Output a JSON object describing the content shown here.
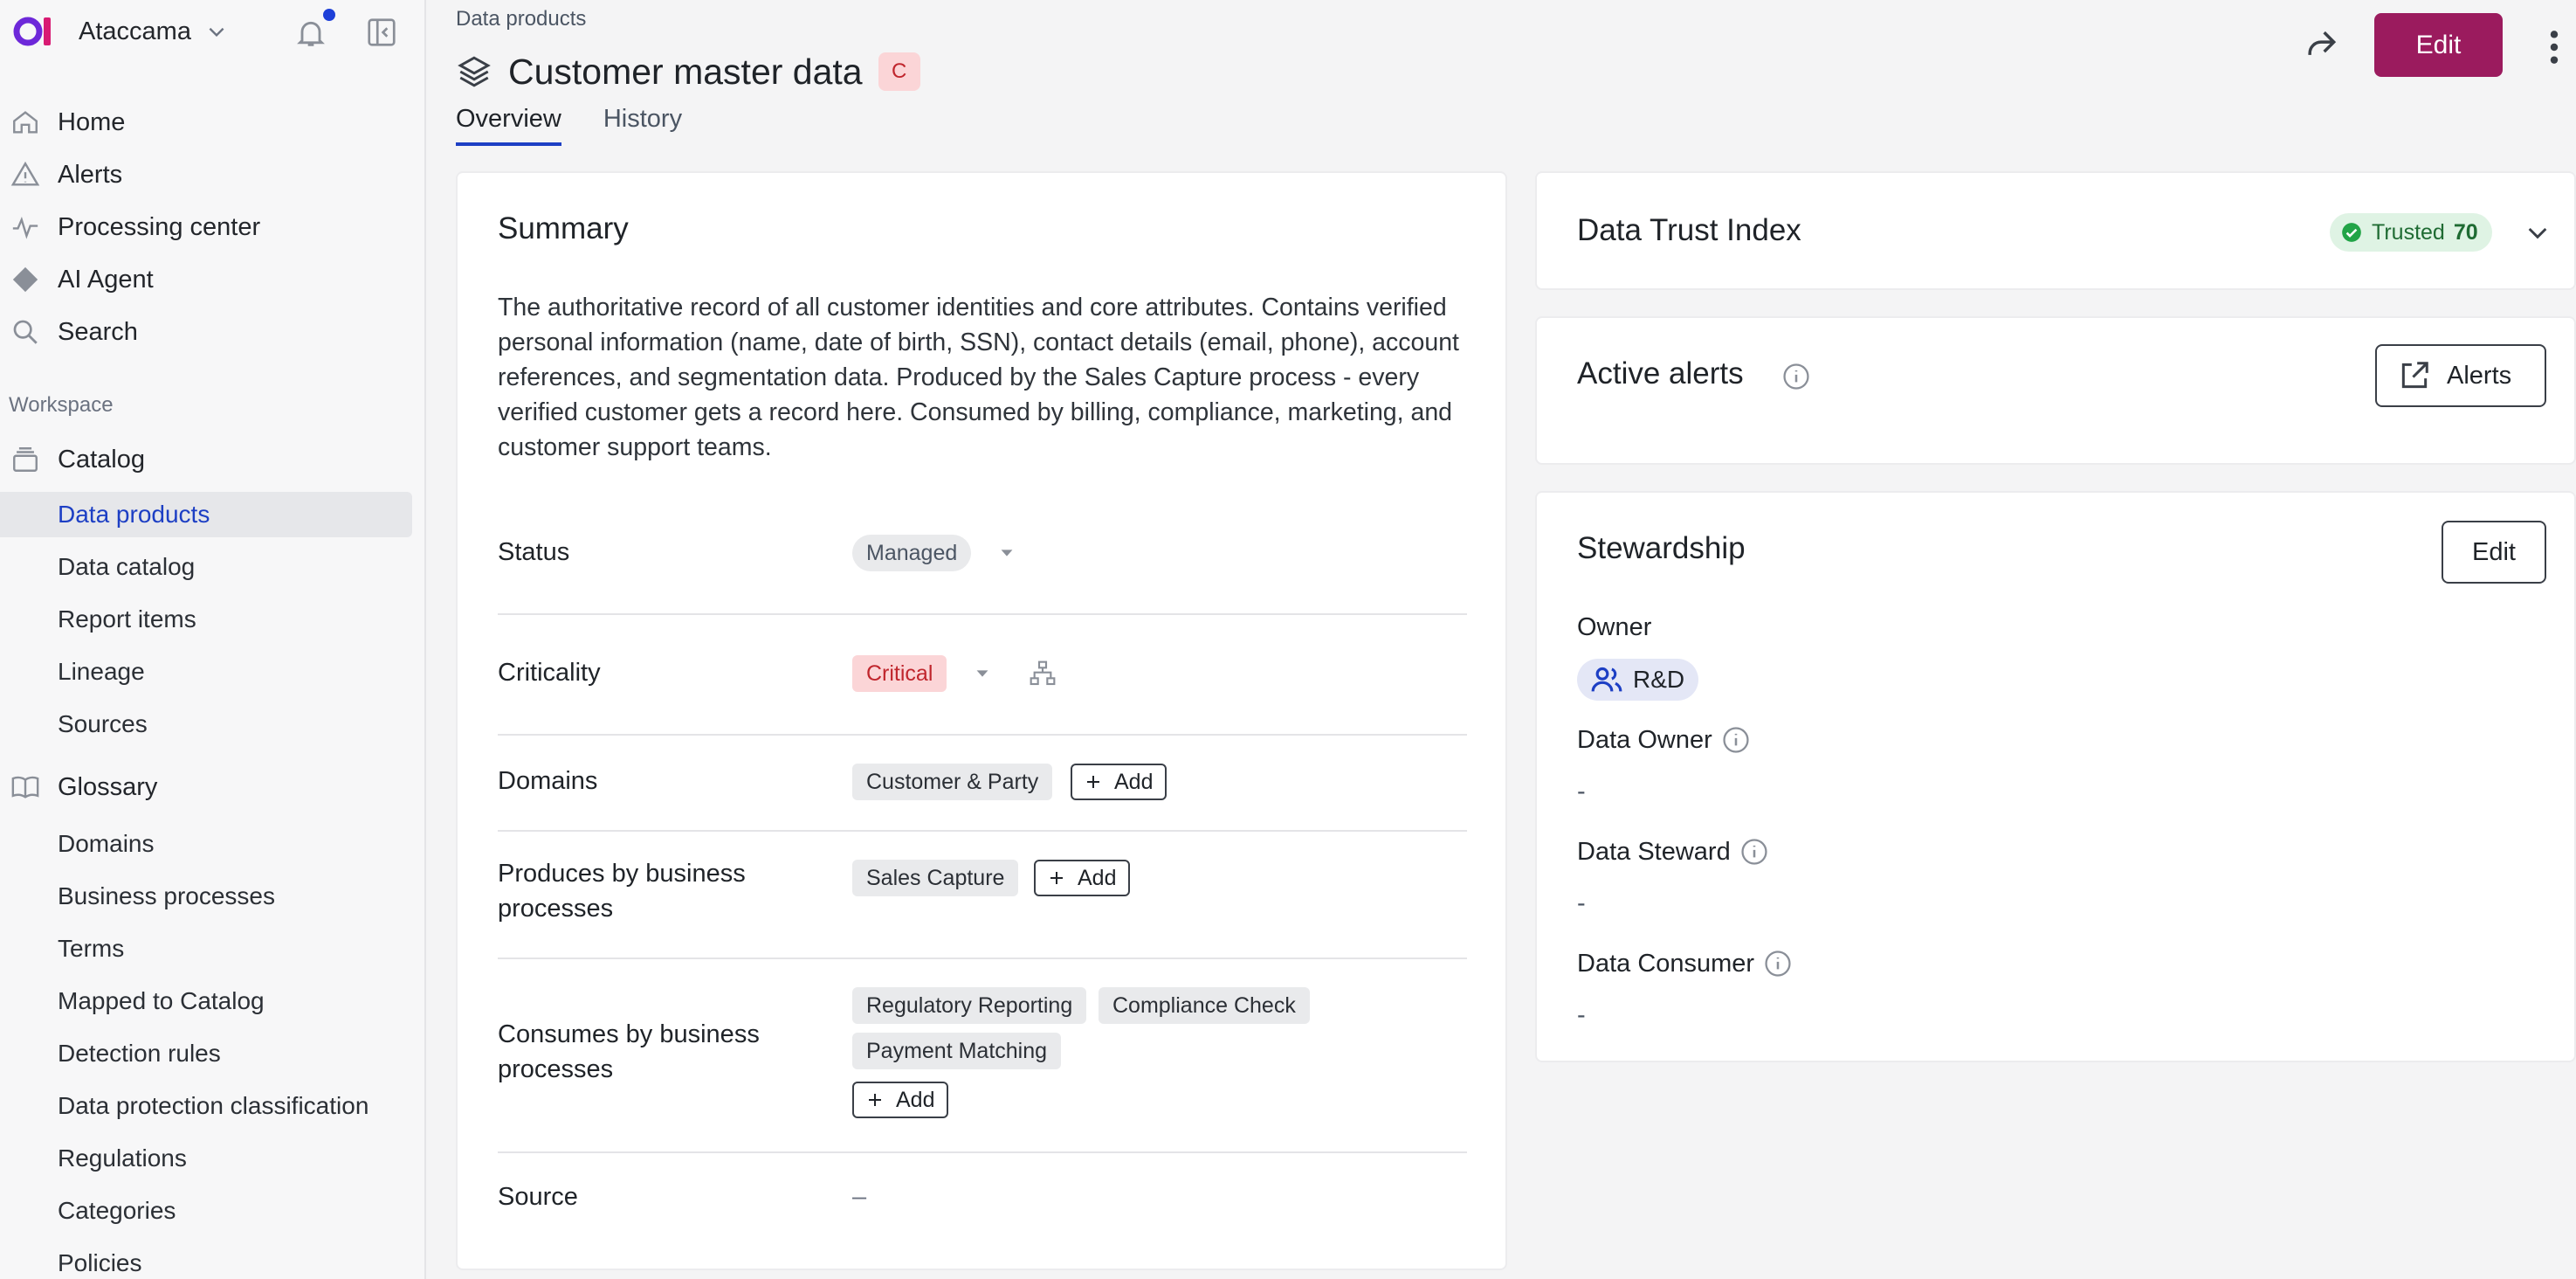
{
  "app": {
    "name": "Ataccama"
  },
  "sidebar": {
    "primary": [
      {
        "label": "Home",
        "icon": "home-icon"
      },
      {
        "label": "Alerts",
        "icon": "warning-icon"
      },
      {
        "label": "Processing center",
        "icon": "activity-icon"
      },
      {
        "label": "AI Agent",
        "icon": "diamond-icon"
      },
      {
        "label": "Search",
        "icon": "search-icon"
      }
    ],
    "workspace_label": "Workspace",
    "catalog": {
      "label": "Catalog",
      "items": [
        "Data products",
        "Data catalog",
        "Report items",
        "Lineage",
        "Sources"
      ],
      "active": "Data products"
    },
    "glossary": {
      "label": "Glossary",
      "items": [
        "Domains",
        "Business processes",
        "Terms",
        "Mapped to Catalog",
        "Detection rules",
        "Data protection classification",
        "Regulations",
        "Categories",
        "Policies"
      ]
    }
  },
  "header": {
    "breadcrumb": "Data products",
    "title": "Customer master data",
    "criticality_badge": "C",
    "tabs": [
      "Overview",
      "History"
    ],
    "active_tab": "Overview",
    "edit_label": "Edit"
  },
  "summary": {
    "title": "Summary",
    "description": "The authoritative record of all customer identities and core attributes. Contains verified personal information (name, date of birth, SSN), contact details (email, phone), account references, and segmentation data. Produced by the Sales Capture process - every verified customer gets a record here. Consumed by billing, compliance, marketing, and customer support teams.",
    "status": {
      "label": "Status",
      "value": "Managed"
    },
    "criticality": {
      "label": "Criticality",
      "value": "Critical"
    },
    "domains": {
      "label": "Domains",
      "values": [
        "Customer & Party"
      ]
    },
    "produces": {
      "label": "Produces by business processes",
      "values": [
        "Sales Capture"
      ]
    },
    "consumes": {
      "label": "Consumes by business processes",
      "values": [
        "Regulatory Reporting",
        "Compliance Check",
        "Payment Matching"
      ]
    },
    "source": {
      "label": "Source",
      "value": "–"
    },
    "add_label": "Add"
  },
  "trust": {
    "title": "Data Trust Index",
    "badge_label": "Trusted",
    "score": "70"
  },
  "alerts": {
    "title": "Active alerts",
    "button_label": "Alerts"
  },
  "stewardship": {
    "title": "Stewardship",
    "edit_label": "Edit",
    "owner_label": "Owner",
    "owner_value": "R&D",
    "data_owner_label": "Data Owner",
    "data_owner_value": "-",
    "data_steward_label": "Data Steward",
    "data_steward_value": "-",
    "data_consumer_label": "Data Consumer",
    "data_consumer_value": "-"
  },
  "colors": {
    "accent": "#9b1b5e",
    "active_nav": "#1d3fc4",
    "critical": "#c0262d",
    "trusted": "#1f6b33"
  }
}
